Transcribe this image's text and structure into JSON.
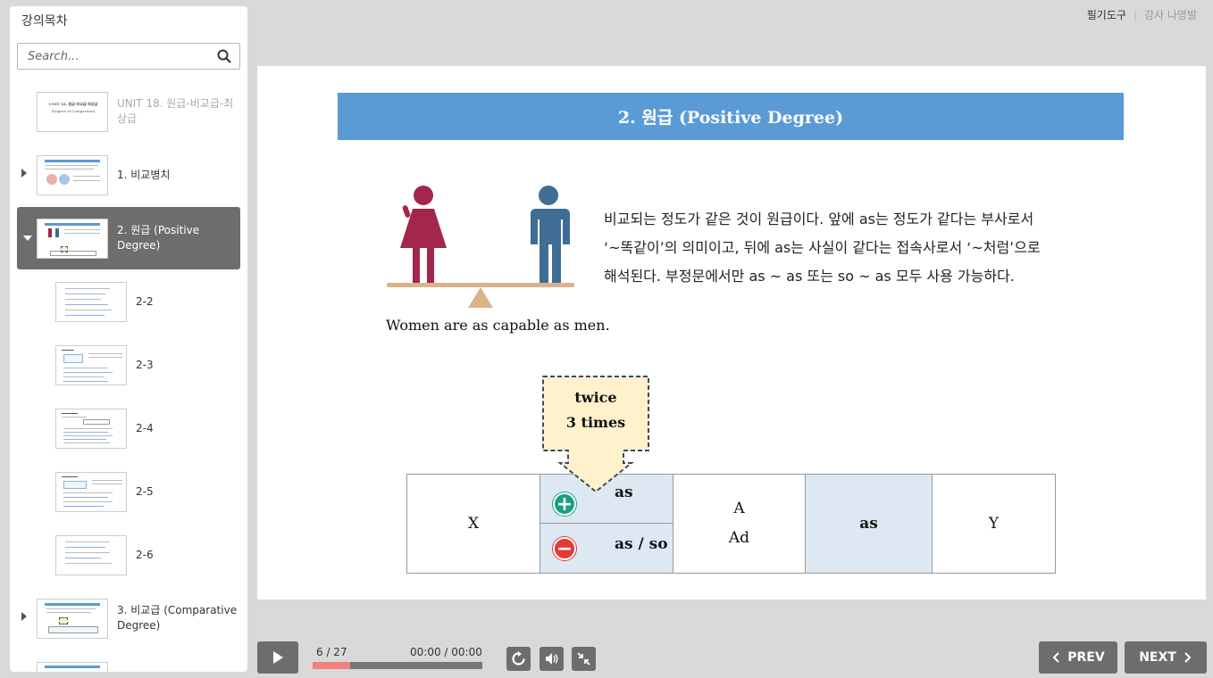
{
  "sidebar": {
    "title": "강의목차",
    "search_placeholder": "Search...",
    "items": [
      {
        "label": "UNIT 18. 원급-비교급-최상급",
        "thumb_title": "UNIT 18. 원급-비교급-최상급",
        "thumb_sub": "(Degree of Comparison)"
      },
      {
        "label": "1. 비교병치"
      },
      {
        "label": "2. 원급 (Positive Degree)"
      },
      {
        "label": "3. 비교급 (Comparative Degree)"
      }
    ],
    "sub_items": [
      {
        "label": "2-2"
      },
      {
        "label": "2-3"
      },
      {
        "label": "2-4"
      },
      {
        "label": "2-5"
      },
      {
        "label": "2-6"
      }
    ]
  },
  "toplinks": {
    "notes_tool": "필기도구",
    "teacher": "강사 나영발"
  },
  "slide": {
    "title": "2. 원급 (Positive Degree)",
    "description_lines": [
      "비교되는 정도가 같은 것이 원급이다. 앞에 as는 정도가 같다는 부사로서",
      "‘~똑같이’의 의미이고, 뒤에 as는 사실이 같다는 접속사로서 ‘~처럼’으로",
      "해석된다. 부정문에서만 as ~ as 또는 so ~ as 모두 사용 가능하다."
    ],
    "caption": "Women are as capable as men.",
    "callout": {
      "line1": "twice",
      "line2": "3 times"
    },
    "table": {
      "x": "X",
      "as_top": "as",
      "as_bottom": "as / so",
      "a": "A",
      "ad": "Ad",
      "as": "as",
      "y": "Y"
    }
  },
  "player": {
    "slide_counter": "6 / 27",
    "time": "00:00 / 00:00",
    "progress": 0.22,
    "prev_label": "PREV",
    "next_label": "NEXT"
  },
  "colors": {
    "title_bar": "#5b9bd5",
    "highlight_cell": "#dde8f3",
    "woman": "#a3264b",
    "man": "#3f6d94",
    "progress_fill": "#f47f7f"
  }
}
